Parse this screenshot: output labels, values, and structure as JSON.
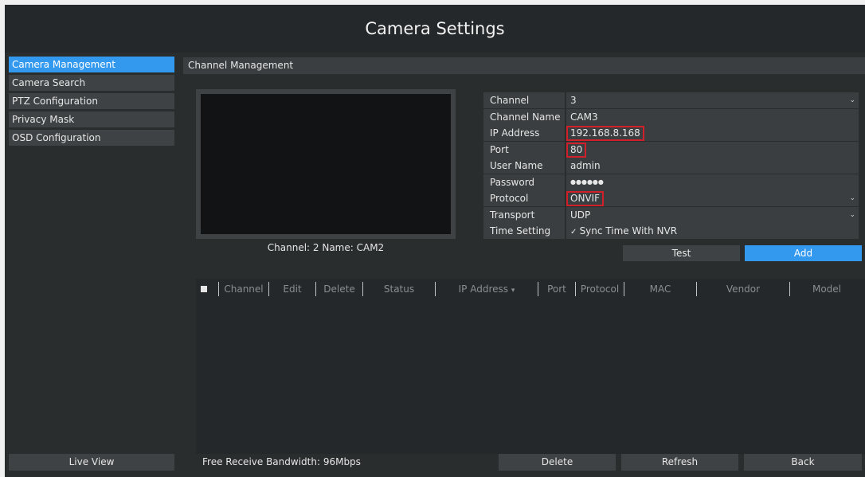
{
  "app": {
    "title": "Camera Settings"
  },
  "sidebar": {
    "items": [
      {
        "label": "Camera Management",
        "active": true
      },
      {
        "label": "Camera Search"
      },
      {
        "label": "PTZ Configuration"
      },
      {
        "label": "Privacy Mask"
      },
      {
        "label": "OSD Configuration"
      }
    ],
    "live_view_label": "Live View"
  },
  "main": {
    "section_title": "Channel Management",
    "preview_caption": "Channel: 2 Name: CAM2",
    "form": {
      "channel": {
        "label": "Channel",
        "value": "3"
      },
      "channel_name": {
        "label": "Channel Name",
        "value": "CAM3"
      },
      "ip_address": {
        "label": "IP Address",
        "value": "192.168.8.168"
      },
      "port": {
        "label": "Port",
        "value": "80"
      },
      "user_name": {
        "label": "User Name",
        "value": "admin"
      },
      "password": {
        "label": "Password",
        "value": "●●●●●●"
      },
      "protocol": {
        "label": "Protocol",
        "value": "ONVIF"
      },
      "transport_protocol": {
        "label": "Transport Protocol",
        "value": "UDP"
      },
      "time_setting": {
        "label": "Time Setting",
        "value": "Sync Time With NVR",
        "checked": true
      }
    },
    "test_label": "Test",
    "add_label": "Add",
    "table": {
      "columns": [
        "Channel",
        "Edit",
        "Delete",
        "Status",
        "IP Address",
        "Port",
        "Protocol",
        "MAC",
        "Vendor",
        "Model"
      ],
      "rows": []
    },
    "footer": {
      "bandwidth": "Free Receive Bandwidth: 96Mbps",
      "delete_label": "Delete",
      "refresh_label": "Refresh",
      "back_label": "Back"
    }
  },
  "colors": {
    "accent": "#3399ee",
    "highlight_box": "#d0202a"
  }
}
